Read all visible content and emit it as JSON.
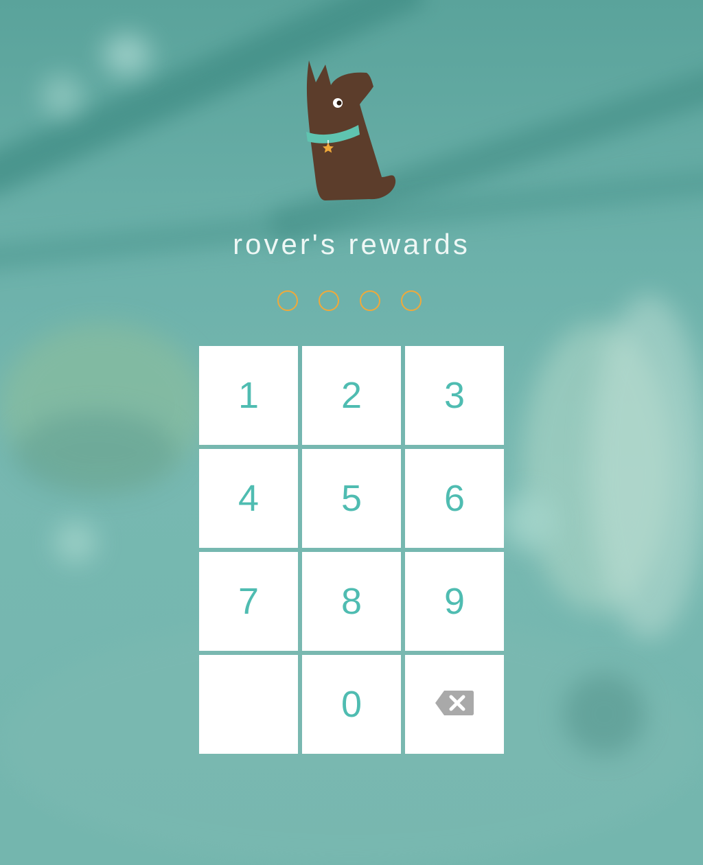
{
  "app": {
    "title": "rover's rewards"
  },
  "pin": {
    "length": 4,
    "entered": 0,
    "dot_color": "#f0a93a"
  },
  "keypad": {
    "keys": [
      {
        "label": "1"
      },
      {
        "label": "2"
      },
      {
        "label": "3"
      },
      {
        "label": "4"
      },
      {
        "label": "5"
      },
      {
        "label": "6"
      },
      {
        "label": "7"
      },
      {
        "label": "8"
      },
      {
        "label": "9"
      },
      {
        "label": ""
      },
      {
        "label": "0"
      },
      {
        "icon": "backspace-icon"
      }
    ],
    "digit_color": "#4fbcb1"
  },
  "logo": {
    "icon": "dog-logo-icon",
    "colors": {
      "body": "#5c3d2b",
      "collar": "#5fc4b0",
      "tag": "#f0a93a"
    }
  }
}
